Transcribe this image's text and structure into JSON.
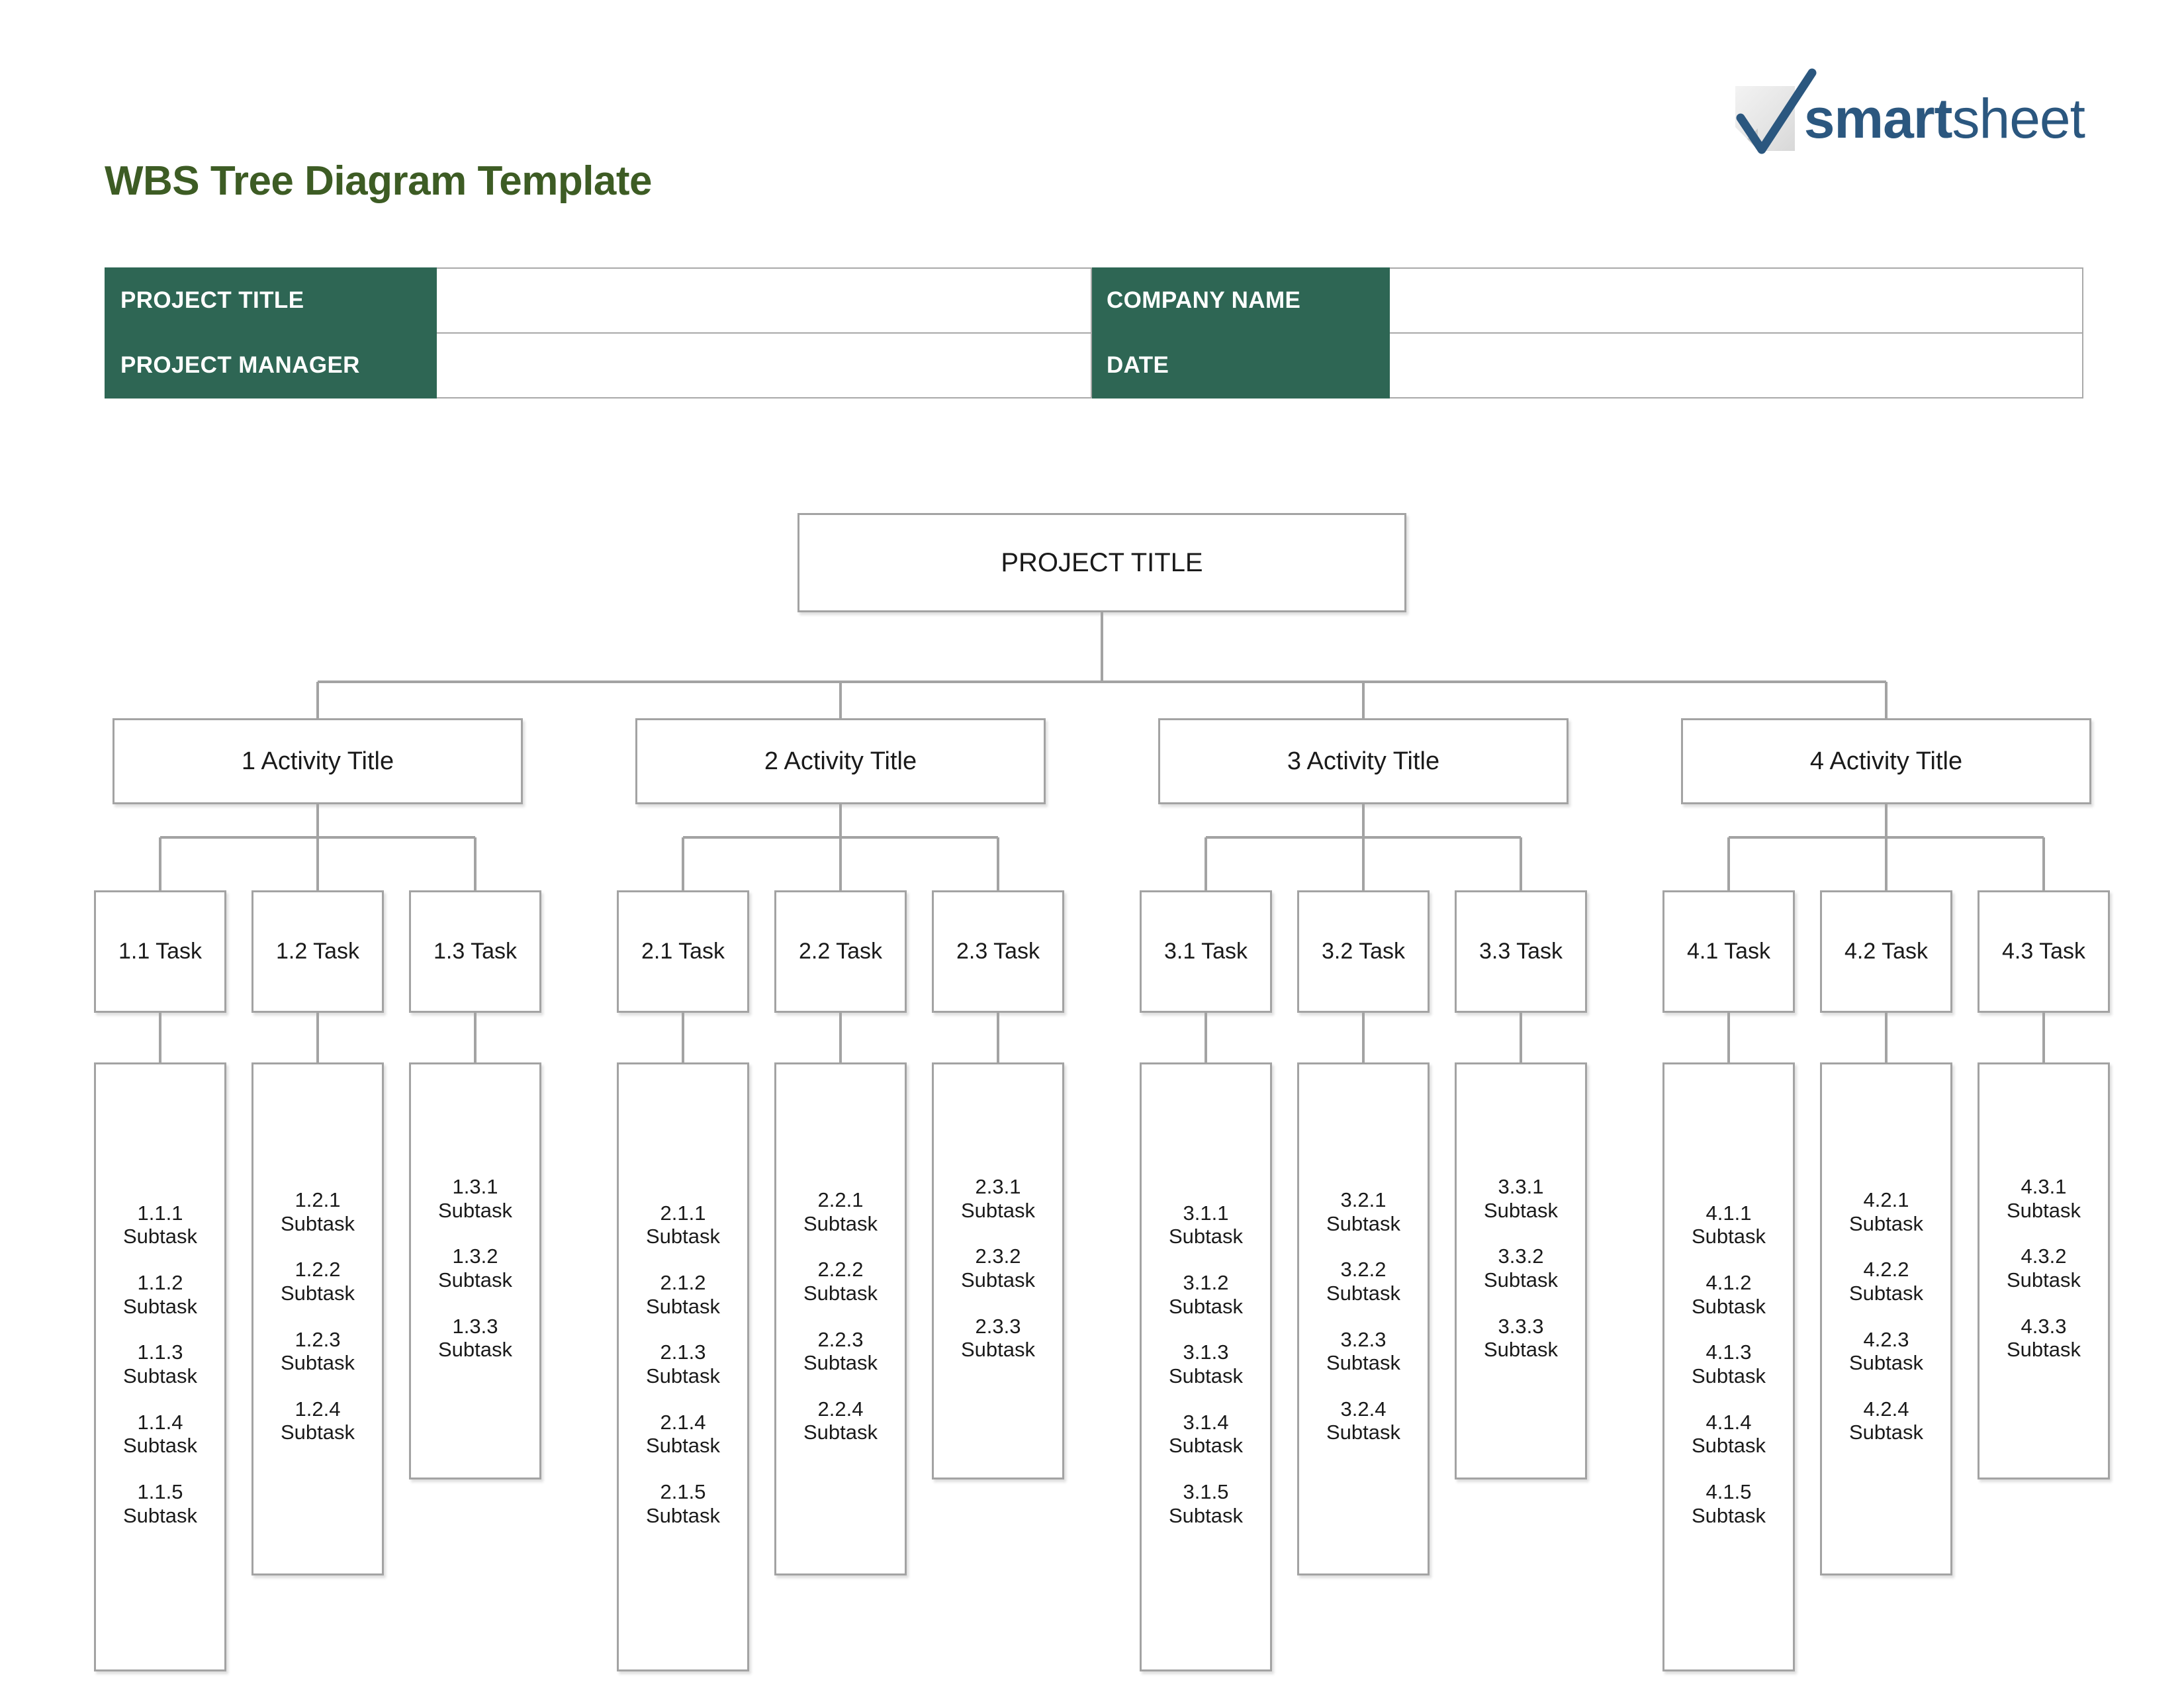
{
  "page": {
    "title": "WBS Tree Diagram Template",
    "title_color": "#3d5c24",
    "accent_color": "#2e6654",
    "border_color": "#a3a3a3"
  },
  "logo": {
    "mark": "checkmark-icon",
    "word_bold": "smart",
    "word_light": "sheet",
    "color": "#2b577f"
  },
  "info_table": {
    "rows": [
      {
        "label_left": "PROJECT TITLE",
        "value_left": "",
        "label_right": "COMPANY NAME",
        "value_right": ""
      },
      {
        "label_left": "PROJECT MANAGER",
        "value_left": "",
        "label_right": "DATE",
        "value_right": ""
      }
    ]
  },
  "diagram": {
    "type": "tree",
    "root": {
      "label": "PROJECT TITLE"
    },
    "activities": [
      {
        "label": "1 Activity Title",
        "tasks": [
          {
            "label": "1.1 Task",
            "subtasks": [
              {
                "id": "1.1.1",
                "label": "Subtask"
              },
              {
                "id": "1.1.2",
                "label": "Subtask"
              },
              {
                "id": "1.1.3",
                "label": "Subtask"
              },
              {
                "id": "1.1.4",
                "label": "Subtask"
              },
              {
                "id": "1.1.5",
                "label": "Subtask"
              }
            ]
          },
          {
            "label": "1.2 Task",
            "subtasks": [
              {
                "id": "1.2.1",
                "label": "Subtask"
              },
              {
                "id": "1.2.2",
                "label": "Subtask"
              },
              {
                "id": "1.2.3",
                "label": "Subtask"
              },
              {
                "id": "1.2.4",
                "label": "Subtask"
              }
            ]
          },
          {
            "label": "1.3 Task",
            "subtasks": [
              {
                "id": "1.3.1",
                "label": "Subtask"
              },
              {
                "id": "1.3.2",
                "label": "Subtask"
              },
              {
                "id": "1.3.3",
                "label": "Subtask"
              }
            ]
          }
        ]
      },
      {
        "label": "2 Activity Title",
        "tasks": [
          {
            "label": "2.1 Task",
            "subtasks": [
              {
                "id": "2.1.1",
                "label": "Subtask"
              },
              {
                "id": "2.1.2",
                "label": "Subtask"
              },
              {
                "id": "2.1.3",
                "label": "Subtask"
              },
              {
                "id": "2.1.4",
                "label": "Subtask"
              },
              {
                "id": "2.1.5",
                "label": "Subtask"
              }
            ]
          },
          {
            "label": "2.2 Task",
            "subtasks": [
              {
                "id": "2.2.1",
                "label": "Subtask"
              },
              {
                "id": "2.2.2",
                "label": "Subtask"
              },
              {
                "id": "2.2.3",
                "label": "Subtask"
              },
              {
                "id": "2.2.4",
                "label": "Subtask"
              }
            ]
          },
          {
            "label": "2.3 Task",
            "subtasks": [
              {
                "id": "2.3.1",
                "label": "Subtask"
              },
              {
                "id": "2.3.2",
                "label": "Subtask"
              },
              {
                "id": "2.3.3",
                "label": "Subtask"
              }
            ]
          }
        ]
      },
      {
        "label": "3 Activity Title",
        "tasks": [
          {
            "label": "3.1 Task",
            "subtasks": [
              {
                "id": "3.1.1",
                "label": "Subtask"
              },
              {
                "id": "3.1.2",
                "label": "Subtask"
              },
              {
                "id": "3.1.3",
                "label": "Subtask"
              },
              {
                "id": "3.1.4",
                "label": "Subtask"
              },
              {
                "id": "3.1.5",
                "label": "Subtask"
              }
            ]
          },
          {
            "label": "3.2 Task",
            "subtasks": [
              {
                "id": "3.2.1",
                "label": "Subtask"
              },
              {
                "id": "3.2.2",
                "label": "Subtask"
              },
              {
                "id": "3.2.3",
                "label": "Subtask"
              },
              {
                "id": "3.2.4",
                "label": "Subtask"
              }
            ]
          },
          {
            "label": "3.3 Task",
            "subtasks": [
              {
                "id": "3.3.1",
                "label": "Subtask"
              },
              {
                "id": "3.3.2",
                "label": "Subtask"
              },
              {
                "id": "3.3.3",
                "label": "Subtask"
              }
            ]
          }
        ]
      },
      {
        "label": "4 Activity Title",
        "tasks": [
          {
            "label": "4.1 Task",
            "subtasks": [
              {
                "id": "4.1.1",
                "label": "Subtask"
              },
              {
                "id": "4.1.2",
                "label": "Subtask"
              },
              {
                "id": "4.1.3",
                "label": "Subtask"
              },
              {
                "id": "4.1.4",
                "label": "Subtask"
              },
              {
                "id": "4.1.5",
                "label": "Subtask"
              }
            ]
          },
          {
            "label": "4.2 Task",
            "subtasks": [
              {
                "id": "4.2.1",
                "label": "Subtask"
              },
              {
                "id": "4.2.2",
                "label": "Subtask"
              },
              {
                "id": "4.2.3",
                "label": "Subtask"
              },
              {
                "id": "4.2.4",
                "label": "Subtask"
              }
            ]
          },
          {
            "label": "4.3 Task",
            "subtasks": [
              {
                "id": "4.3.1",
                "label": "Subtask"
              },
              {
                "id": "4.3.2",
                "label": "Subtask"
              },
              {
                "id": "4.3.3",
                "label": "Subtask"
              }
            ]
          }
        ]
      }
    ]
  }
}
